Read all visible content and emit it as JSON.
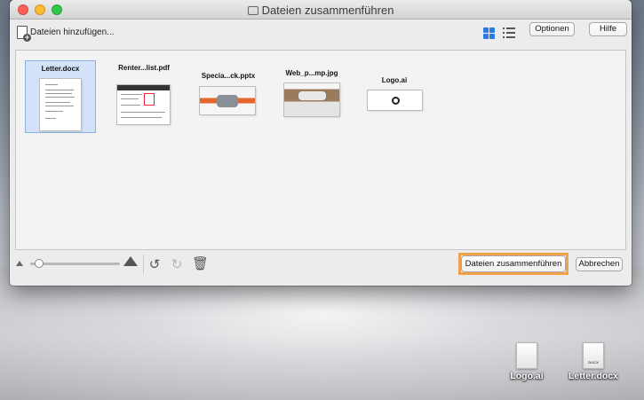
{
  "window": {
    "title": "Dateien zusammenführen"
  },
  "toolbar": {
    "add_files_label": "Dateien hinzufügen...",
    "options_label": "Optionen",
    "help_label": "Hilfe"
  },
  "files": [
    {
      "name": "Letter.docx",
      "icon": "docx-thumbnail",
      "selected": true
    },
    {
      "name": "Renter...list.pdf",
      "icon": "pdf-thumbnail",
      "selected": false
    },
    {
      "name": "Specia...ck.pptx",
      "icon": "pptx-thumbnail",
      "selected": false
    },
    {
      "name": "Web_p...mp.jpg",
      "icon": "jpg-thumbnail",
      "selected": false
    },
    {
      "name": "Logo.ai",
      "icon": "ai-thumbnail",
      "selected": false
    }
  ],
  "bottom": {
    "merge_label": "Dateien zusammenführen",
    "cancel_label": "Abbrechen",
    "zoom_level": 0.1,
    "accent_highlight": "#f0a24a"
  },
  "desktop": {
    "icons": [
      {
        "label": "Logo.ai",
        "type_text": ""
      },
      {
        "label": "Letter.docx",
        "type_text": "DOCX"
      }
    ]
  },
  "colors": {
    "selection": "#d3e2f8",
    "grid_view_icon": "#2a7ae2"
  }
}
